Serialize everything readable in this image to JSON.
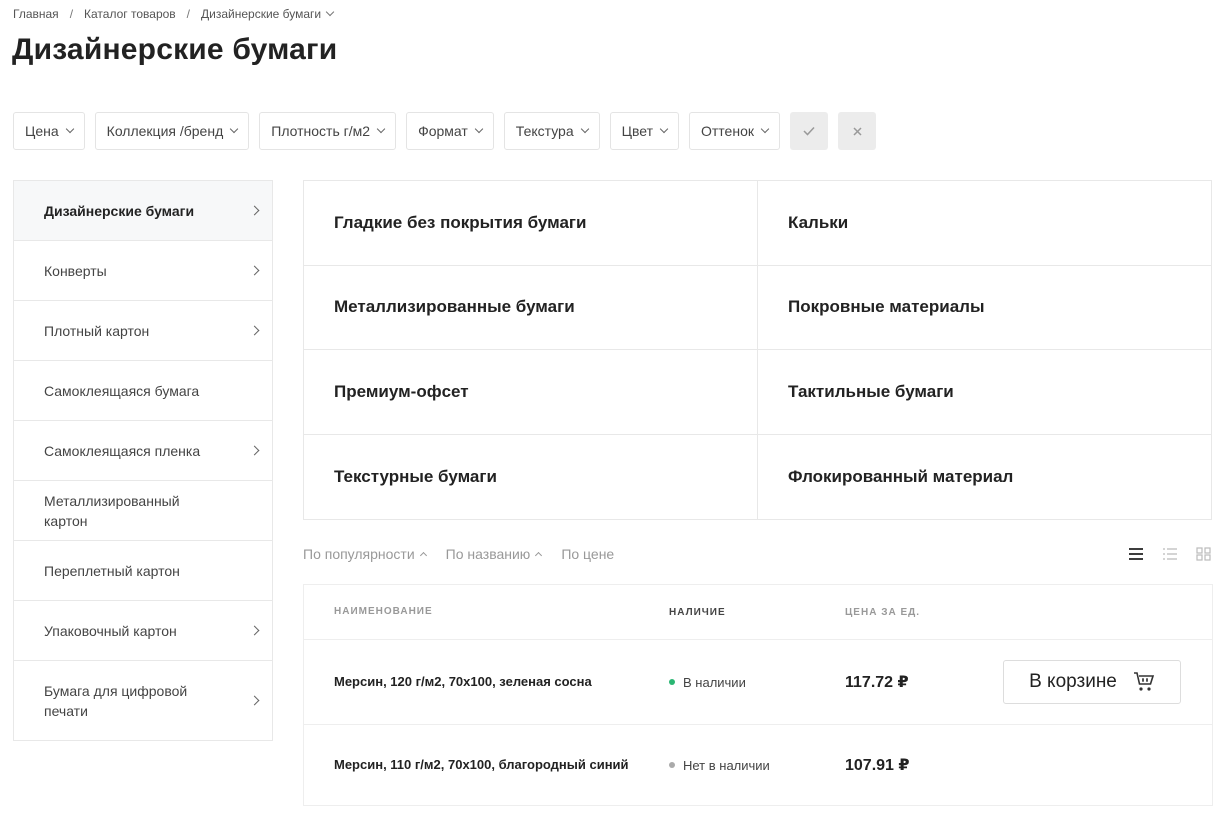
{
  "breadcrumb": [
    "Главная",
    "Каталог товаров",
    "Дизайнерские бумаги"
  ],
  "page_title": "Дизайнерские бумаги",
  "filters": [
    "Цена",
    "Коллекция /бренд",
    "Плотность г/м2",
    "Формат",
    "Текстура",
    "Цвет",
    "Оттенок"
  ],
  "filter_buttons": {
    "apply_icon": "check-icon",
    "reset_icon": "close-icon"
  },
  "sidebar": [
    {
      "label": "Дизайнерские бумаги",
      "arrow": true,
      "active": true
    },
    {
      "label": "Конверты",
      "arrow": true
    },
    {
      "label": "Плотный картон",
      "arrow": true
    },
    {
      "label": "Самоклеящаяся бумага",
      "arrow": false
    },
    {
      "label": "Самоклеящаяся пленка",
      "arrow": true
    },
    {
      "label": "Металлизированный картон",
      "arrow": false
    },
    {
      "label": "Переплетный картон",
      "arrow": false
    },
    {
      "label": "Упаковочный картон",
      "arrow": true
    },
    {
      "label": "Бумага для цифровой печати",
      "arrow": true
    }
  ],
  "categories": [
    "Гладкие без покрытия бумаги",
    "Кальки",
    "Металлизированные бумаги",
    "Покровные материалы",
    "Премиум-офсет",
    "Тактильные бумаги",
    "Текстурные бумаги",
    "Флокированный материал"
  ],
  "sort": {
    "popularity": "По популярности",
    "name": "По названию",
    "price": "По цене"
  },
  "views": [
    "list-view-icon",
    "compact-list-icon",
    "grid-view-icon"
  ],
  "table": {
    "headers": {
      "name": "НАИМЕНОВАНИЕ",
      "stock": "НАЛИЧИЕ",
      "price": "ЦЕНА ЗА ЕД."
    },
    "rows": [
      {
        "name": "Мерсин, 120 г/м2, 70х100, зеленая сосна",
        "stock": "В наличии",
        "in_stock": true,
        "price": "117.72 ₽",
        "cart_label": "В корзине"
      },
      {
        "name": "Мерсин, 110 г/м2, 70х100, благородный синий",
        "stock": "Нет в наличии",
        "in_stock": false,
        "price": "107.91 ₽"
      }
    ]
  },
  "colors": {
    "in_stock": "#2bb673",
    "out_of_stock": "#aaaaaa",
    "active_bg": "#f7f8f9"
  }
}
